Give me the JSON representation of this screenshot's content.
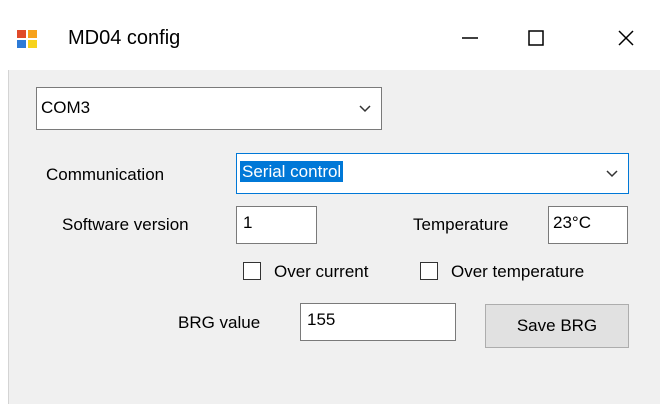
{
  "window": {
    "title": "MD04 config",
    "minimize_icon": "minimize-icon",
    "maximize_icon": "maximize-icon",
    "close_icon": "close-icon"
  },
  "port": {
    "selected": "COM3"
  },
  "communication": {
    "label": "Communication",
    "selected": "Serial control"
  },
  "software_version": {
    "label": "Software version",
    "value": "1"
  },
  "temperature": {
    "label": "Temperature",
    "value": "23°C"
  },
  "over_current": {
    "label": "Over current",
    "checked": false
  },
  "over_temperature": {
    "label": "Over temperature",
    "checked": false
  },
  "brg": {
    "label": "BRG value",
    "value": "155",
    "save_label": "Save BRG"
  },
  "colors": {
    "selection": "#0078d7",
    "focus_border": "#0078d7",
    "client_bg": "#f0f0f0"
  }
}
